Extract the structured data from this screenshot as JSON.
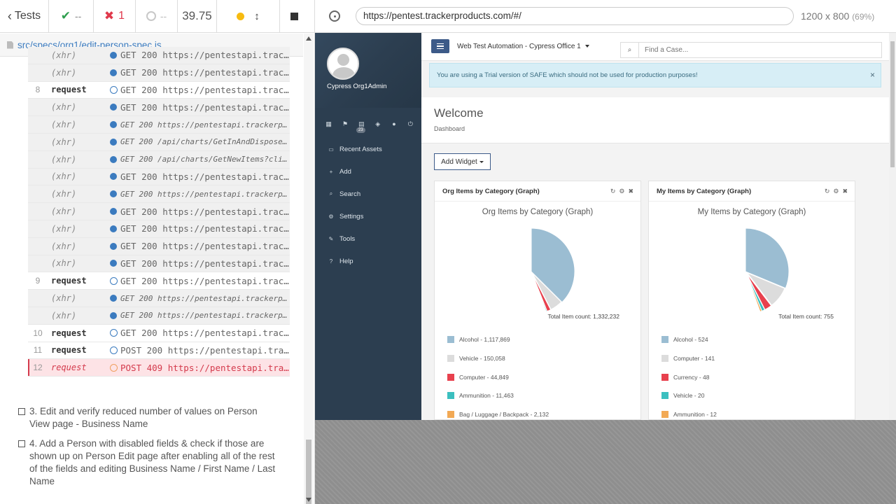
{
  "runner": {
    "tests_label": "Tests",
    "passed": "--",
    "failed": "1",
    "pending": "--",
    "duration": "39.75",
    "spec_path": "src/specs/org1/edit-person-spec.js",
    "commands": [
      {
        "num": "",
        "name": "(xhr)",
        "kind": "xhr",
        "small": false,
        "msg": "GET 200 https://pentestapi.trac..."
      },
      {
        "num": "",
        "name": "(xhr)",
        "kind": "xhr",
        "small": false,
        "msg": "GET 200 https://pentestapi.trac..."
      },
      {
        "num": "8",
        "name": "request",
        "kind": "req",
        "small": false,
        "msg": "GET 200 https://pentestapi.trac..."
      },
      {
        "num": "",
        "name": "(xhr)",
        "kind": "xhr",
        "small": false,
        "msg": "GET 200 https://pentestapi.trac..."
      },
      {
        "num": "",
        "name": "(xhr)",
        "kind": "xhr",
        "small": true,
        "msg": "GET 200 https://pentestapi.trackerprod..."
      },
      {
        "num": "",
        "name": "(xhr)",
        "kind": "xhr",
        "small": true,
        "msg": "GET 200 /api/charts/GetInAndDisposedIt..."
      },
      {
        "num": "",
        "name": "(xhr)",
        "kind": "xhr",
        "small": true,
        "msg": "GET 200 /api/charts/GetNewItems?client..."
      },
      {
        "num": "",
        "name": "(xhr)",
        "kind": "xhr",
        "small": false,
        "msg": "GET 200 https://pentestapi.trac..."
      },
      {
        "num": "",
        "name": "(xhr)",
        "kind": "xhr",
        "small": true,
        "msg": "GET 200 https://pentestapi.trackerprod..."
      },
      {
        "num": "",
        "name": "(xhr)",
        "kind": "xhr",
        "small": false,
        "msg": "GET 200 https://pentestapi.trac..."
      },
      {
        "num": "",
        "name": "(xhr)",
        "kind": "xhr",
        "small": false,
        "msg": "GET 200 https://pentestapi.trac..."
      },
      {
        "num": "",
        "name": "(xhr)",
        "kind": "xhr",
        "small": false,
        "msg": "GET 200 https://pentestapi.trac..."
      },
      {
        "num": "",
        "name": "(xhr)",
        "kind": "xhr",
        "small": false,
        "msg": "GET 200 https://pentestapi.trac..."
      },
      {
        "num": "9",
        "name": "request",
        "kind": "req",
        "small": false,
        "msg": "GET 200 https://pentestapi.trac..."
      },
      {
        "num": "",
        "name": "(xhr)",
        "kind": "xhr",
        "small": true,
        "msg": "GET 200 https://pentestapi.trackerprod..."
      },
      {
        "num": "",
        "name": "(xhr)",
        "kind": "xhr",
        "small": true,
        "msg": "GET 200 https://pentestapi.trackerprod..."
      },
      {
        "num": "10",
        "name": "request",
        "kind": "req",
        "small": false,
        "msg": "GET 200 https://pentestapi.trac..."
      },
      {
        "num": "11",
        "name": "request",
        "kind": "req",
        "small": false,
        "msg": "POST 200 https://pentestapi.tra..."
      },
      {
        "num": "12",
        "name": "request",
        "kind": "err",
        "small": false,
        "msg": "POST 409 https://pentestapi.tra..."
      }
    ],
    "tests": [
      {
        "title": "3. Edit and verify reduced number of values on Person View page - Business Name"
      },
      {
        "title": "4. Add a Person with disabled fields & check if those are shown up on Person Edit page after enabling all of the rest of the fields and editing Business Name / First Name / Last Name"
      }
    ]
  },
  "browser": {
    "url": "https://pentest.trackerproducts.com/#/",
    "viewport": "1200 x 800",
    "scale": "(69%)"
  },
  "app": {
    "user": "Cypress Org1Admin",
    "badge": "23",
    "menu": [
      {
        "icon": "laptop-icon",
        "glyph": "▭",
        "label": "Recent Assets"
      },
      {
        "icon": "plus-icon",
        "glyph": "+",
        "label": "Add"
      },
      {
        "icon": "search-icon",
        "glyph": "⌕",
        "label": "Search"
      },
      {
        "icon": "gears-icon",
        "glyph": "⚙",
        "label": "Settings"
      },
      {
        "icon": "wrench-icon",
        "glyph": "✎",
        "label": "Tools"
      },
      {
        "icon": "help-icon",
        "glyph": "?",
        "label": "Help"
      }
    ],
    "office": "Web Test Automation - Cypress Office 1",
    "case_placeholder": "Find a Case...",
    "alert": "You are using a Trial version of SAFE which should not be used for production purposes!",
    "welcome_title": "Welcome",
    "breadcrumb": "Dashboard",
    "add_widget": "Add Widget"
  },
  "colors": {
    "alcohol": "#9bbdd2",
    "vehicle": "#dcdcdc",
    "red": "#e8414e",
    "teal": "#3bbfbf",
    "orange": "#f2a955"
  },
  "chart_data": [
    {
      "type": "pie",
      "header": "Org Items by Category (Graph)",
      "title": "Org Items by Category (Graph)",
      "total_label": "Total Item count: 1,332,232",
      "categories": [
        "Alcohol",
        "Vehicle",
        "Computer",
        "Ammunition",
        "Bag / Luggage / Backpack"
      ],
      "values": [
        1117869,
        150058,
        44849,
        11463,
        2132
      ],
      "legend": [
        "Alcohol - 1,117,869",
        "Vehicle - 150,058",
        "Computer - 44,849",
        "Ammunition - 11,463",
        "Bag / Luggage / Backpack - 2,132"
      ],
      "colors": [
        "#9bbdd2",
        "#dcdcdc",
        "#e8414e",
        "#3bbfbf",
        "#f2a955"
      ]
    },
    {
      "type": "pie",
      "header": "My Items by Category (Graph)",
      "title": "My Items by Category (Graph)",
      "total_label": "Total Item count: 755",
      "categories": [
        "Alcohol",
        "Computer",
        "Currency",
        "Vehicle",
        "Ammunition"
      ],
      "values": [
        524,
        141,
        48,
        20,
        12
      ],
      "legend": [
        "Alcohol - 524",
        "Computer - 141",
        "Currency - 48",
        "Vehicle - 20",
        "Ammunition - 12"
      ],
      "colors": [
        "#9bbdd2",
        "#dcdcdc",
        "#e8414e",
        "#3bbfbf",
        "#f2a955"
      ]
    }
  ]
}
